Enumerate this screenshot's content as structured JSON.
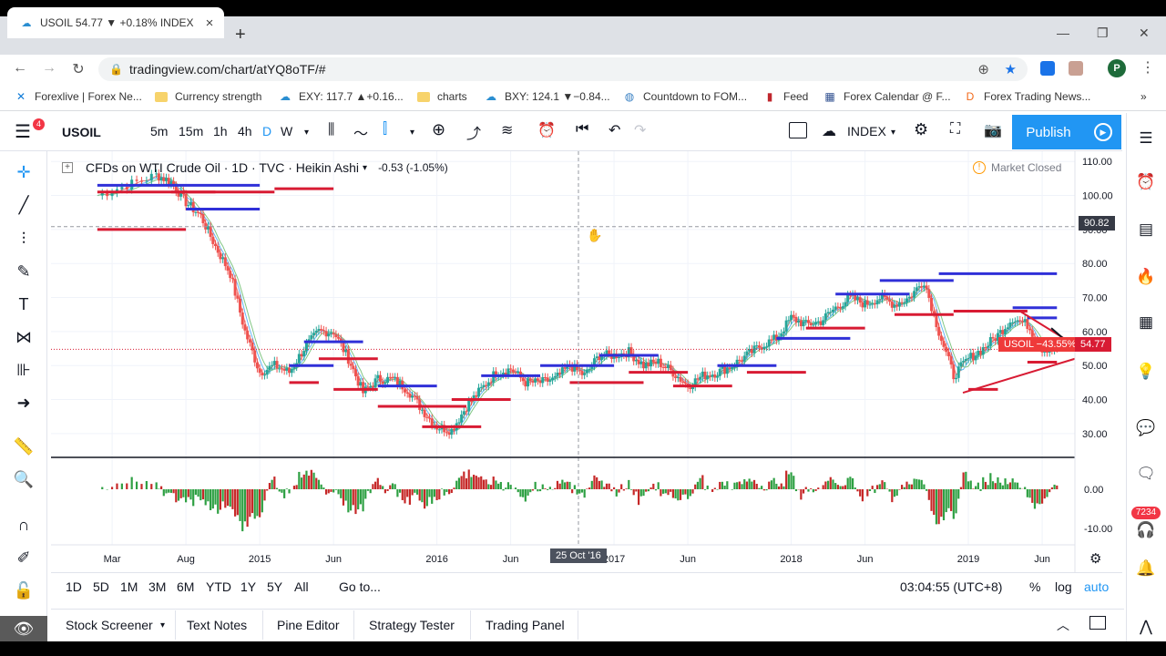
{
  "browser": {
    "tab_title": "USOIL 54.77 ▼ +0.18% INDEX",
    "url": "tradingview.com/chart/atYQ8oTF/#",
    "avatar_letter": "P",
    "bookmarks": [
      {
        "label": "Forexlive | Forex Ne...",
        "icon": "x-icon",
        "color": "#0f7bd8"
      },
      {
        "label": "Currency strength",
        "icon": "folder-icon",
        "color": "#f7d36b"
      },
      {
        "label": "EXY: 117.7 ▲+0.16...",
        "icon": "tradingview-icon",
        "color": "#2a8ed1"
      },
      {
        "label": "charts",
        "icon": "folder-icon",
        "color": "#f7d36b"
      },
      {
        "label": "BXY: 124.1 ▼−0.84...",
        "icon": "tradingview-icon",
        "color": "#2a8ed1"
      },
      {
        "label": "Countdown to FOM...",
        "icon": "globe-icon",
        "color": "#3b82c4"
      },
      {
        "label": "Feed",
        "icon": "feed-icon",
        "color": "#c0272d"
      },
      {
        "label": "Forex Calendar @ F...",
        "icon": "calendar-icon",
        "color": "#2f4f8f"
      },
      {
        "label": "Forex Trading News...",
        "icon": "dfx-icon",
        "color": "#f26a1b"
      }
    ]
  },
  "toolbar": {
    "symbol": "USOIL",
    "alert_count": "4",
    "intervals": [
      "5m",
      "15m",
      "1h",
      "4h",
      "D",
      "W"
    ],
    "active_interval": "D",
    "index_label": "INDEX",
    "publish_label": "Publish"
  },
  "legend": {
    "title": "CFDs on WTI Crude Oil · 1D · TVC · Heikin Ashi",
    "change": "-0.53 (-1.05%)",
    "market_status": "Market Closed"
  },
  "price_tags": {
    "crosshair": "90.82",
    "symbol_tag": "USOIL −43.55%",
    "last": "54.77",
    "crosshair_date": "25 Oct '16"
  },
  "timeframes": [
    "1D",
    "5D",
    "1M",
    "3M",
    "6M",
    "YTD",
    "1Y",
    "5Y",
    "All"
  ],
  "goto_label": "Go to...",
  "clock": "03:04:55 (UTC+8)",
  "scale_options": {
    "percent": "%",
    "log": "log",
    "auto": "auto"
  },
  "bottom_tabs": [
    "Stock Screener",
    "Text Notes",
    "Pine Editor",
    "Strategy Tester",
    "Trading Panel"
  ],
  "notification_count": "7234",
  "colors": {
    "accent": "#2196f3",
    "up": "#26a69a",
    "down": "#ef5350",
    "resistance": "#3030d8",
    "support": "#d81b33"
  },
  "chart_data": {
    "type": "line",
    "title": "CFDs on WTI Crude Oil · 1D · TVC · Heikin Ashi",
    "price_axis_ticks": [
      "110.00",
      "100.00",
      "90.00",
      "80.00",
      "70.00",
      "60.00",
      "50.00",
      "40.00",
      "30.00"
    ],
    "ylim": [
      23,
      113
    ],
    "time_axis_ticks": [
      "Mar",
      "Aug",
      "2015",
      "Jun",
      "2016",
      "Jun",
      "2017",
      "Jun",
      "2018",
      "Jun",
      "2019",
      "Jun"
    ],
    "series": [
      {
        "name": "USOIL",
        "x": [
          "2014-02",
          "2014-04",
          "2014-06",
          "2014-07",
          "2014-08",
          "2014-09",
          "2014-10",
          "2014-11",
          "2014-12",
          "2015-01",
          "2015-02",
          "2015-03",
          "2015-04",
          "2015-05",
          "2015-06",
          "2015-07",
          "2015-08",
          "2015-09",
          "2015-10",
          "2015-11",
          "2015-12",
          "2016-01",
          "2016-02",
          "2016-03",
          "2016-04",
          "2016-05",
          "2016-06",
          "2016-07",
          "2016-08",
          "2016-09",
          "2016-10",
          "2016-11",
          "2016-12",
          "2017-01",
          "2017-02",
          "2017-03",
          "2017-04",
          "2017-05",
          "2017-06",
          "2017-07",
          "2017-08",
          "2017-09",
          "2017-10",
          "2017-11",
          "2017-12",
          "2018-01",
          "2018-02",
          "2018-03",
          "2018-04",
          "2018-05",
          "2018-06",
          "2018-07",
          "2018-08",
          "2018-09",
          "2018-10",
          "2018-11",
          "2018-12",
          "2019-01",
          "2019-02",
          "2019-03",
          "2019-04",
          "2019-05",
          "2019-06",
          "2019-07"
        ],
        "values": [
          100,
          103,
          106,
          104,
          98,
          94,
          85,
          77,
          60,
          48,
          50,
          48,
          55,
          60,
          60,
          52,
          42,
          46,
          46,
          43,
          37,
          32,
          31,
          38,
          43,
          48,
          49,
          45,
          45,
          46,
          50,
          47,
          53,
          53,
          54,
          50,
          51,
          48,
          44,
          47,
          48,
          50,
          53,
          56,
          58,
          64,
          62,
          63,
          67,
          70,
          68,
          70,
          68,
          70,
          75,
          60,
          47,
          52,
          55,
          59,
          64,
          62,
          55,
          55
        ]
      }
    ],
    "indicator_ticks": [
      "0.00",
      "-10.00"
    ]
  }
}
